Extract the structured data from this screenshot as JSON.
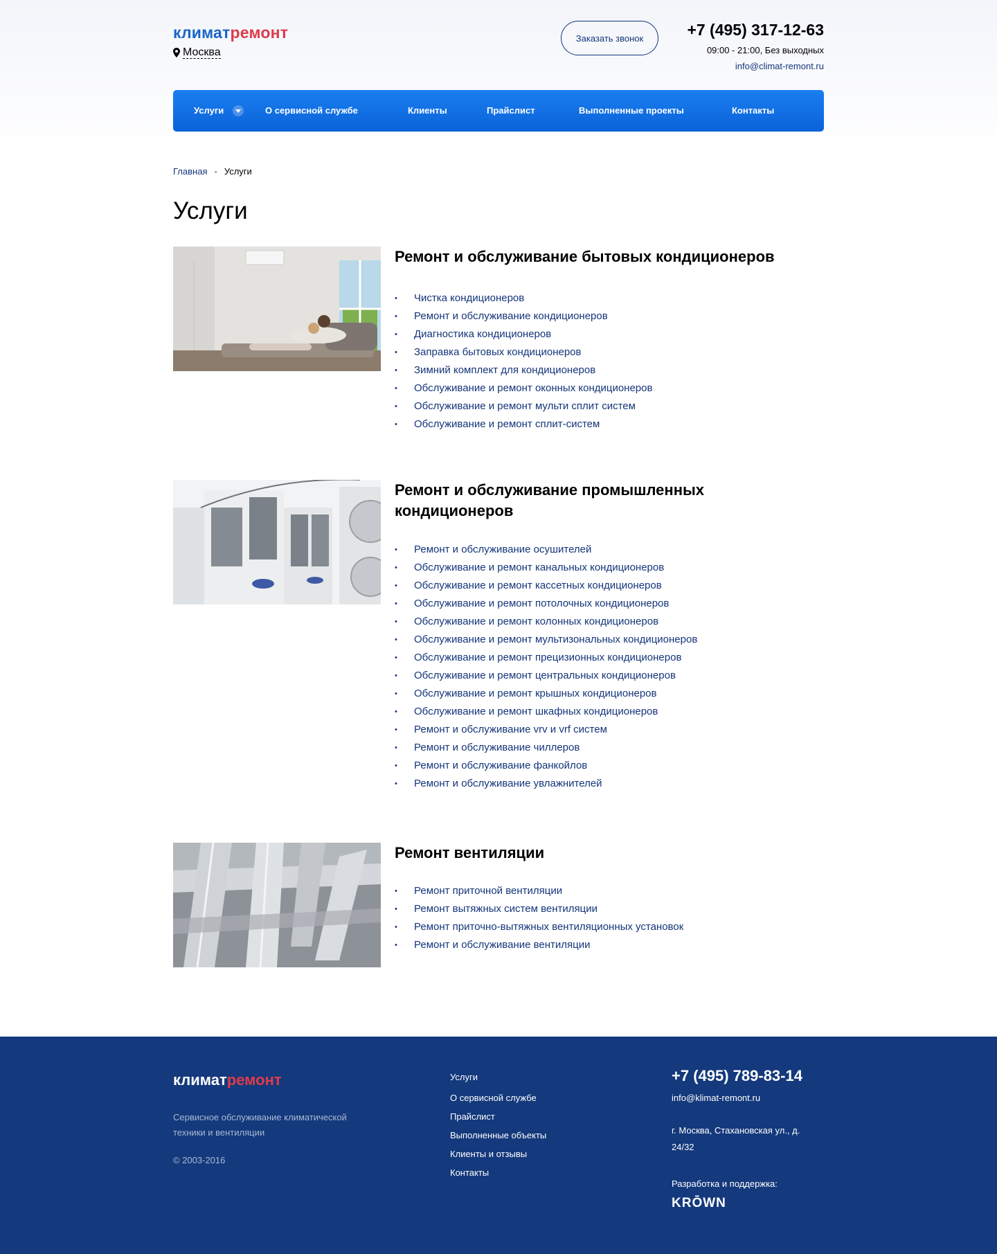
{
  "brand": {
    "part1": "климат",
    "part2": "ремонт",
    "accent_blue": "#1a64c9",
    "accent_red": "#e03a4b"
  },
  "header": {
    "city": "Москва",
    "callback_label": "Заказать звонок",
    "phone": "+7 (495) 317-12-63",
    "hours": "09:00 - 21:00, Без выходных",
    "email": "info@climat-remont.ru"
  },
  "nav": {
    "items": [
      {
        "label": "Услуги"
      },
      {
        "label": "О сервисной службе"
      },
      {
        "label": "Клиенты"
      },
      {
        "label": "Прайслист"
      },
      {
        "label": "Выполненные проекты"
      },
      {
        "label": "Контакты"
      }
    ],
    "color": "#0f6fe3"
  },
  "breadcrumb": {
    "home": "Главная",
    "separator": "-",
    "current": "Услуги"
  },
  "page_title": "Услуги",
  "sections": [
    {
      "title": "Ремонт и обслуживание бытовых кондиционеров",
      "items": [
        "Чистка кондиционеров",
        "Ремонт и обслуживание кондиционеров",
        "Диагностика кондиционеров",
        "Заправка бытовых кондиционеров",
        "Зимний комплект для кондиционеров",
        "Обслуживание и ремонт оконных кондиционеров",
        "Обслуживание и ремонт мульти сплит систем",
        "Обслуживание и ремонт сплит-систем"
      ]
    },
    {
      "title": "Ремонт и обслуживание промышленных кондиционеров",
      "items": [
        "Ремонт и обслуживание осушителей",
        "Обслуживание и ремонт канальных кондиционеров",
        "Обслуживание и ремонт кассетных кондиционеров",
        "Обслуживание и ремонт потолочных кондиционеров",
        "Обслуживание и ремонт колонных кондиционеров",
        "Обслуживание и ремонт мультизональных кондиционеров",
        "Обслуживание и ремонт прецизионных кондиционеров",
        "Обслуживание и ремонт центральных кондиционеров",
        "Обслуживание и ремонт крышных кондиционеров",
        "Обслуживание и ремонт шкафных кондиционеров",
        "Ремонт и обслуживание vrv и vrf систем",
        "Ремонт и обслуживание чиллеров",
        "Ремонт и обслуживание фанкойлов",
        "Ремонт и обслуживание увлажнителей"
      ]
    },
    {
      "title": "Ремонт вентиляции",
      "items": [
        "Ремонт приточной вентиляции",
        "Ремонт вытяжных систем вентиляции",
        "Ремонт приточно-вытяжных вентиляционных установок",
        "Ремонт и обслуживание вентиляции"
      ]
    }
  ],
  "footer": {
    "description": "Сервисное обслуживание климатической техники и вентиляции",
    "copyright": "© 2003-2016",
    "menu": [
      "Услуги",
      "О сервисной службе",
      "Прайслист",
      "Выполненные объекты",
      "Клиенты и отзывы",
      "Контакты"
    ],
    "phone": "+7 (495) 789-83-14",
    "email": "info@klimat-remont.ru",
    "address": "г. Москва, Стахановская ул., д. 24/32",
    "dev_label": "Разработка и поддержка:",
    "dev_logo": "KRŌWN",
    "bg_color": "#14397c"
  }
}
